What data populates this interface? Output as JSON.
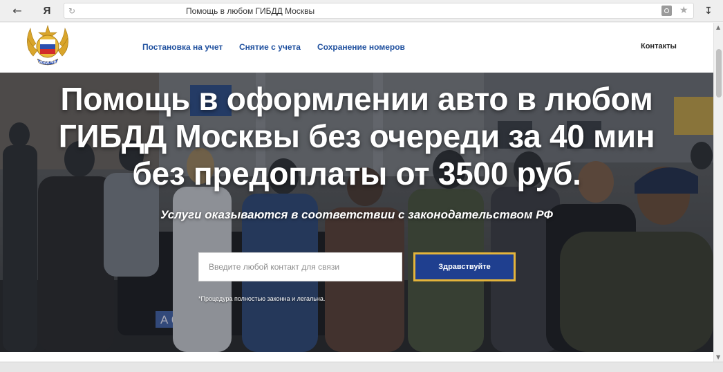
{
  "browser": {
    "back_icon": "arrow-left-icon",
    "logo_text": "Я",
    "reload_icon": "reload-icon",
    "page_title": "Помощь в любом ГИБДД Москвы",
    "extension_icon": "extension-icon",
    "bookmark_icon": "star-icon",
    "download_icon": "download-icon"
  },
  "header": {
    "logo_icon": "gibdd-emblem-icon",
    "logo_text": "ГИБДД МВД",
    "nav": [
      {
        "label": "Постановка на учет"
      },
      {
        "label": "Снятие с учета"
      },
      {
        "label": "Сохранение номеров"
      }
    ],
    "contacts_label": "Контакты"
  },
  "hero": {
    "headline_lines": [
      "Помощь в оформлении авто в любом",
      "ГИБДД Москвы без очереди за 40 мин",
      "без предоплаты от 3500 руб."
    ],
    "subtitle": "Услуги оказываются в соответствии с законодательством РФ",
    "input_placeholder": "Введите любой контакт для связи",
    "input_value": "",
    "button_label": "Здравствуйте",
    "disclaimer": "*Процедура полностью законна и легальна.",
    "license_plate": "А 0 2"
  },
  "colors": {
    "nav_link": "#1e4f9e",
    "button_bg": "#1f3f8f",
    "button_border": "#e4b43b",
    "headline": "#ffffff"
  }
}
